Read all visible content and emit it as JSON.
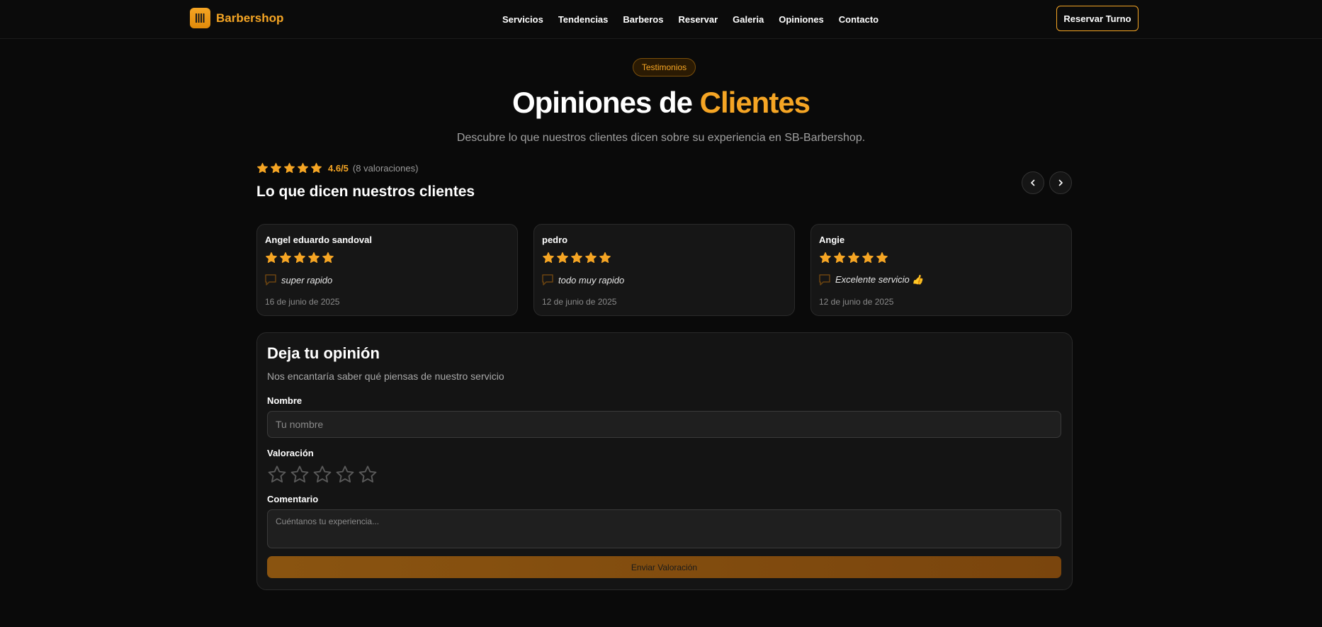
{
  "nav": {
    "brand": "Barbershop",
    "brand_icon": "barber-pole-icon",
    "links": [
      "Servicios",
      "Tendencias",
      "Barberos",
      "Reservar",
      "Galeria",
      "Opiniones",
      "Contacto"
    ],
    "cta": "Reservar Turno"
  },
  "hero": {
    "badge": "Testimonios",
    "title_plain": "Opiniones de ",
    "title_accent": "Clientes",
    "subtitle": "Descubre lo que nuestros clientes dicen sobre su experiencia en SB-Barbershop."
  },
  "summary": {
    "stars": 5,
    "score": "4.6/5",
    "count": "(8 valoraciones)",
    "heading": "Lo que dicen nuestros clientes",
    "prev_icon": "chevron-left-icon",
    "next_icon": "chevron-right-icon"
  },
  "reviews": [
    {
      "name": "Angel eduardo sandoval",
      "rating": 5,
      "comment": "super rapido",
      "date": "16 de junio de 2025"
    },
    {
      "name": "pedro",
      "rating": 5,
      "comment": "todo muy rapido",
      "date": "12 de junio de 2025"
    },
    {
      "name": "Angie",
      "rating": 5,
      "comment": "Excelente servicio 👍",
      "date": "12 de junio de 2025"
    }
  ],
  "form": {
    "title": "Deja tu opinión",
    "subtitle": "Nos encantaría saber qué piensas de nuestro servicio",
    "name_label": "Nombre",
    "name_placeholder": "Tu nombre",
    "rating_label": "Valoración",
    "rating_value": 0,
    "comment_label": "Comentario",
    "comment_placeholder": "Cuéntanos tu experiencia...",
    "submit": "Enviar Valoración"
  },
  "colors": {
    "accent": "#f5a524",
    "background": "#0a0a0a",
    "card": "#161616"
  }
}
